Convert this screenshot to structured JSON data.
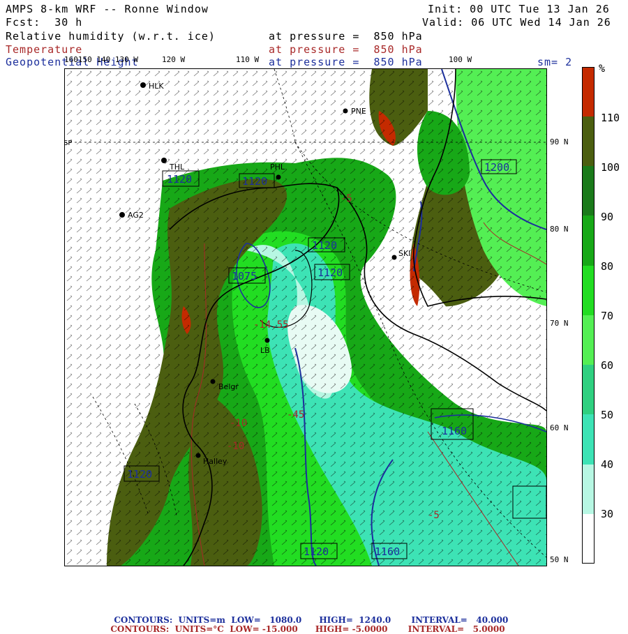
{
  "header": {
    "title": "AMPS 8-km WRF -- Ronne Window",
    "forecast": "Fcst:  30 h",
    "init": "Init: 00 UTC Tue 13 Jan 26",
    "valid": "Valid: 06 UTC Wed 14 Jan 26",
    "fields": [
      {
        "name": "Relative humidity (w.r.t. ice)",
        "level": "at pressure =  850 hPa",
        "color": "#000000"
      },
      {
        "name": "Temperature",
        "level": "at pressure =  850 hPa",
        "color": "#a82828"
      },
      {
        "name": "Geopotential Height",
        "level": "at pressure =  850 hPa",
        "color": "#1c2f9c"
      }
    ],
    "smoothing": "sm= 2"
  },
  "map": {
    "lon_labels": [
      "160150 140 130 W",
      "120 W",
      "110 W",
      "100 W"
    ],
    "lat_labels": [
      "90 N",
      "80 N",
      "70 N",
      "60 N",
      "50 N"
    ],
    "pole_label": "SP",
    "stations": [
      "HLK",
      "PNE",
      "THL",
      "PHL",
      "AG2",
      "SKI",
      "LB",
      "Belgr",
      "Halley"
    ],
    "height_labels": [
      "1120",
      "1120",
      "1200",
      "1120",
      "1120",
      "1075",
      "1120",
      "1160",
      "1120",
      "1120",
      "1160"
    ],
    "temp_labels": [
      "-10",
      "-10",
      "-45",
      "-5",
      "-5",
      "-14.55"
    ]
  },
  "colorbar": {
    "unit": "%",
    "ticks": [
      "110",
      "100",
      "90",
      "80",
      "70",
      "60",
      "50",
      "40",
      "30"
    ],
    "colors": [
      "#c42a00",
      "#4b5e10",
      "#1a7a1a",
      "#17a817",
      "#22dd22",
      "#54ef54",
      "#2fd080",
      "#3de3b5",
      "#b7f7e3",
      "#ffffff"
    ]
  },
  "footer": {
    "height": {
      "label": "CONTOURS:",
      "units": "UNITS=m",
      "low": "LOW=   1080.0",
      "high": "HIGH=  1240.0",
      "interval": "INTERVAL=   40.000",
      "color": "#1c2f9c"
    },
    "temp": {
      "label": "CONTOURS:",
      "units": "UNITS=°C",
      "low": "LOW= -15.000",
      "high": "HIGH= -5.0000",
      "interval": "INTERVAL=   5.0000",
      "color": "#a82828"
    }
  }
}
